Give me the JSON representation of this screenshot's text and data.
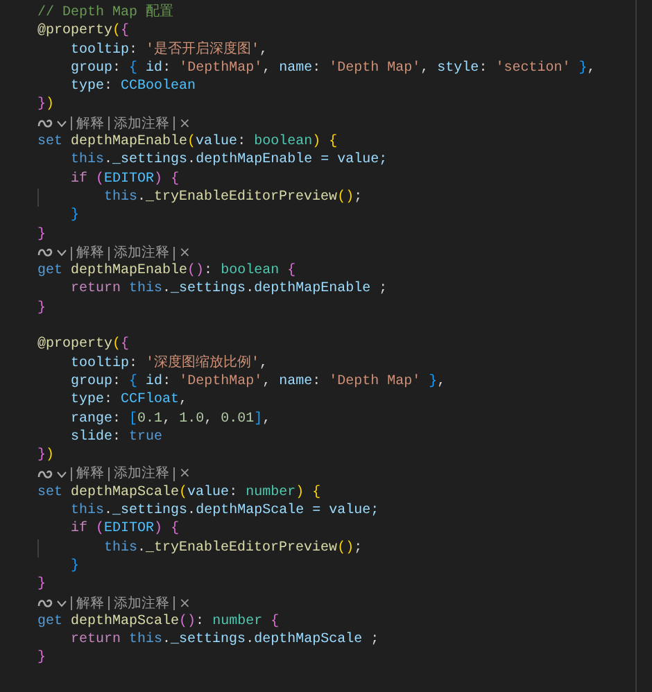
{
  "editor": {
    "lines": [
      {
        "kind": "code",
        "tokens": [
          {
            "text": "// Depth Map 配置",
            "color": "#6a9955"
          }
        ]
      },
      {
        "kind": "code",
        "tokens": [
          {
            "text": "@property",
            "color": "#dcdcaa"
          },
          {
            "text": "(",
            "color": "#ffd700"
          },
          {
            "text": "{",
            "color": "#da70d6"
          }
        ]
      },
      {
        "kind": "code",
        "tokens": [
          {
            "text": "    tooltip",
            "color": "#9cdcfe"
          },
          {
            "text": ": ",
            "color": "#d4d4d4"
          },
          {
            "text": "'是否开启深度图'",
            "color": "#ce9178"
          },
          {
            "text": ",",
            "color": "#d4d4d4"
          }
        ]
      },
      {
        "kind": "code",
        "tokens": [
          {
            "text": "    group",
            "color": "#9cdcfe"
          },
          {
            "text": ": ",
            "color": "#d4d4d4"
          },
          {
            "text": "{",
            "color": "#179fff"
          },
          {
            "text": " id",
            "color": "#9cdcfe"
          },
          {
            "text": ": ",
            "color": "#d4d4d4"
          },
          {
            "text": "'DepthMap'",
            "color": "#ce9178"
          },
          {
            "text": ", ",
            "color": "#d4d4d4"
          },
          {
            "text": "name",
            "color": "#9cdcfe"
          },
          {
            "text": ": ",
            "color": "#d4d4d4"
          },
          {
            "text": "'Depth Map'",
            "color": "#ce9178"
          },
          {
            "text": ", ",
            "color": "#d4d4d4"
          },
          {
            "text": "style",
            "color": "#9cdcfe"
          },
          {
            "text": ": ",
            "color": "#d4d4d4"
          },
          {
            "text": "'section'",
            "color": "#ce9178"
          },
          {
            "text": " }",
            "color": "#179fff"
          },
          {
            "text": ",",
            "color": "#d4d4d4"
          }
        ]
      },
      {
        "kind": "code",
        "tokens": [
          {
            "text": "    type",
            "color": "#9cdcfe"
          },
          {
            "text": ": ",
            "color": "#d4d4d4"
          },
          {
            "text": "CCBoolean",
            "color": "#4fc1ff"
          }
        ]
      },
      {
        "kind": "code",
        "tokens": [
          {
            "text": "}",
            "color": "#da70d6"
          },
          {
            "text": ")",
            "color": "#ffd700"
          }
        ]
      },
      {
        "kind": "codelens",
        "actions": [
          "解释",
          "添加注释"
        ],
        "close": "×"
      },
      {
        "kind": "code",
        "tokens": [
          {
            "text": "set",
            "color": "#569cd6"
          },
          {
            "text": " depthMapEnable",
            "color": "#dcdcaa"
          },
          {
            "text": "(",
            "color": "#ffd700"
          },
          {
            "text": "value",
            "color": "#9cdcfe"
          },
          {
            "text": ": ",
            "color": "#d4d4d4"
          },
          {
            "text": "boolean",
            "color": "#4ec9b0"
          },
          {
            "text": ")",
            "color": "#ffd700"
          },
          {
            "text": " {",
            "color": "#ffd700"
          }
        ]
      },
      {
        "kind": "code",
        "tokens": [
          {
            "text": "    this",
            "color": "#569cd6"
          },
          {
            "text": ".",
            "color": "#d4d4d4"
          },
          {
            "text": "_settings",
            "color": "#9cdcfe"
          },
          {
            "text": ".",
            "color": "#d4d4d4"
          },
          {
            "text": "depthMapEnable",
            "color": "#9cdcfe"
          },
          {
            "text": " = value;",
            "color": "#9cdcfe"
          }
        ]
      },
      {
        "kind": "code",
        "tokens": [
          {
            "text": "    if",
            "color": "#c586c0"
          },
          {
            "text": " (",
            "color": "#da70d6"
          },
          {
            "text": "EDITOR",
            "color": "#4fc1ff"
          },
          {
            "text": ")",
            "color": "#da70d6"
          },
          {
            "text": " {",
            "color": "#da70d6"
          }
        ]
      },
      {
        "kind": "code",
        "tokens": [
          {
            "text": "        this",
            "color": "#569cd6"
          },
          {
            "text": ".",
            "color": "#d4d4d4"
          },
          {
            "text": "_tryEnableEditorPreview",
            "color": "#dcdcaa"
          },
          {
            "text": "()",
            "color": "#ffd700"
          },
          {
            "text": ";",
            "color": "#d4d4d4"
          }
        ]
      },
      {
        "kind": "code",
        "tokens": [
          {
            "text": "    }",
            "color": "#179fff"
          }
        ]
      },
      {
        "kind": "code",
        "tokens": [
          {
            "text": "}",
            "color": "#da70d6"
          }
        ]
      },
      {
        "kind": "codelens",
        "actions": [
          "解释",
          "添加注释"
        ],
        "close": "×"
      },
      {
        "kind": "code",
        "tokens": [
          {
            "text": "get",
            "color": "#569cd6"
          },
          {
            "text": " depthMapEnable",
            "color": "#dcdcaa"
          },
          {
            "text": "()",
            "color": "#da70d6"
          },
          {
            "text": ": ",
            "color": "#d4d4d4"
          },
          {
            "text": "boolean",
            "color": "#4ec9b0"
          },
          {
            "text": " {",
            "color": "#da70d6"
          }
        ]
      },
      {
        "kind": "code",
        "tokens": [
          {
            "text": "    return",
            "color": "#c586c0"
          },
          {
            "text": " this",
            "color": "#569cd6"
          },
          {
            "text": ".",
            "color": "#d4d4d4"
          },
          {
            "text": "_settings",
            "color": "#9cdcfe"
          },
          {
            "text": ".",
            "color": "#d4d4d4"
          },
          {
            "text": "depthMapEnable",
            "color": "#9cdcfe"
          },
          {
            "text": " ;",
            "color": "#d4d4d4"
          }
        ]
      },
      {
        "kind": "code",
        "tokens": [
          {
            "text": "}",
            "color": "#da70d6"
          }
        ]
      },
      {
        "kind": "blank"
      },
      {
        "kind": "code",
        "tokens": [
          {
            "text": "@property",
            "color": "#dcdcaa"
          },
          {
            "text": "(",
            "color": "#ffd700"
          },
          {
            "text": "{",
            "color": "#da70d6"
          }
        ]
      },
      {
        "kind": "code",
        "tokens": [
          {
            "text": "    tooltip",
            "color": "#9cdcfe"
          },
          {
            "text": ": ",
            "color": "#d4d4d4"
          },
          {
            "text": "'深度图缩放比例'",
            "color": "#ce9178"
          },
          {
            "text": ",",
            "color": "#d4d4d4"
          }
        ]
      },
      {
        "kind": "code",
        "tokens": [
          {
            "text": "    group",
            "color": "#9cdcfe"
          },
          {
            "text": ": ",
            "color": "#d4d4d4"
          },
          {
            "text": "{",
            "color": "#179fff"
          },
          {
            "text": " id",
            "color": "#9cdcfe"
          },
          {
            "text": ": ",
            "color": "#d4d4d4"
          },
          {
            "text": "'DepthMap'",
            "color": "#ce9178"
          },
          {
            "text": ", ",
            "color": "#d4d4d4"
          },
          {
            "text": "name",
            "color": "#9cdcfe"
          },
          {
            "text": ": ",
            "color": "#d4d4d4"
          },
          {
            "text": "'Depth Map'",
            "color": "#ce9178"
          },
          {
            "text": " }",
            "color": "#179fff"
          },
          {
            "text": ",",
            "color": "#d4d4d4"
          }
        ]
      },
      {
        "kind": "code",
        "tokens": [
          {
            "text": "    type",
            "color": "#9cdcfe"
          },
          {
            "text": ": ",
            "color": "#d4d4d4"
          },
          {
            "text": "CCFloat",
            "color": "#4fc1ff"
          },
          {
            "text": ",",
            "color": "#d4d4d4"
          }
        ]
      },
      {
        "kind": "code",
        "tokens": [
          {
            "text": "    range",
            "color": "#9cdcfe"
          },
          {
            "text": ": ",
            "color": "#d4d4d4"
          },
          {
            "text": "[",
            "color": "#179fff"
          },
          {
            "text": "0.1",
            "color": "#b5cea8"
          },
          {
            "text": ", ",
            "color": "#d4d4d4"
          },
          {
            "text": "1.0",
            "color": "#b5cea8"
          },
          {
            "text": ", ",
            "color": "#d4d4d4"
          },
          {
            "text": "0.01",
            "color": "#b5cea8"
          },
          {
            "text": "]",
            "color": "#179fff"
          },
          {
            "text": ",",
            "color": "#d4d4d4"
          }
        ]
      },
      {
        "kind": "code",
        "tokens": [
          {
            "text": "    slide",
            "color": "#9cdcfe"
          },
          {
            "text": ": ",
            "color": "#d4d4d4"
          },
          {
            "text": "true",
            "color": "#569cd6"
          }
        ]
      },
      {
        "kind": "code",
        "tokens": [
          {
            "text": "}",
            "color": "#da70d6"
          },
          {
            "text": ")",
            "color": "#ffd700"
          }
        ]
      },
      {
        "kind": "codelens",
        "actions": [
          "解释",
          "添加注释"
        ],
        "close": "×"
      },
      {
        "kind": "code",
        "tokens": [
          {
            "text": "set",
            "color": "#569cd6"
          },
          {
            "text": " depthMapScale",
            "color": "#dcdcaa"
          },
          {
            "text": "(",
            "color": "#ffd700"
          },
          {
            "text": "value",
            "color": "#9cdcfe"
          },
          {
            "text": ": ",
            "color": "#d4d4d4"
          },
          {
            "text": "number",
            "color": "#4ec9b0"
          },
          {
            "text": ")",
            "color": "#ffd700"
          },
          {
            "text": " {",
            "color": "#ffd700"
          }
        ]
      },
      {
        "kind": "code",
        "tokens": [
          {
            "text": "    this",
            "color": "#569cd6"
          },
          {
            "text": ".",
            "color": "#d4d4d4"
          },
          {
            "text": "_settings",
            "color": "#9cdcfe"
          },
          {
            "text": ".",
            "color": "#d4d4d4"
          },
          {
            "text": "depthMapScale",
            "color": "#9cdcfe"
          },
          {
            "text": " = value;",
            "color": "#9cdcfe"
          }
        ]
      },
      {
        "kind": "code",
        "tokens": [
          {
            "text": "    if",
            "color": "#c586c0"
          },
          {
            "text": " (",
            "color": "#da70d6"
          },
          {
            "text": "EDITOR",
            "color": "#4fc1ff"
          },
          {
            "text": ")",
            "color": "#da70d6"
          },
          {
            "text": " {",
            "color": "#da70d6"
          }
        ]
      },
      {
        "kind": "code",
        "tokens": [
          {
            "text": "        this",
            "color": "#569cd6"
          },
          {
            "text": ".",
            "color": "#d4d4d4"
          },
          {
            "text": "_tryEnableEditorPreview",
            "color": "#dcdcaa"
          },
          {
            "text": "()",
            "color": "#ffd700"
          },
          {
            "text": ";",
            "color": "#d4d4d4"
          }
        ]
      },
      {
        "kind": "code",
        "tokens": [
          {
            "text": "    }",
            "color": "#179fff"
          }
        ]
      },
      {
        "kind": "code",
        "tokens": [
          {
            "text": "}",
            "color": "#da70d6"
          }
        ]
      },
      {
        "kind": "codelens",
        "actions": [
          "解释",
          "添加注释"
        ],
        "close": "×"
      },
      {
        "kind": "code",
        "tokens": [
          {
            "text": "get",
            "color": "#569cd6"
          },
          {
            "text": " depthMapScale",
            "color": "#dcdcaa"
          },
          {
            "text": "()",
            "color": "#da70d6"
          },
          {
            "text": ": ",
            "color": "#d4d4d4"
          },
          {
            "text": "number",
            "color": "#4ec9b0"
          },
          {
            "text": " {",
            "color": "#da70d6"
          }
        ]
      },
      {
        "kind": "code",
        "tokens": [
          {
            "text": "    return",
            "color": "#c586c0"
          },
          {
            "text": " this",
            "color": "#569cd6"
          },
          {
            "text": ".",
            "color": "#d4d4d4"
          },
          {
            "text": "_settings",
            "color": "#9cdcfe"
          },
          {
            "text": ".",
            "color": "#d4d4d4"
          },
          {
            "text": "depthMapScale",
            "color": "#9cdcfe"
          },
          {
            "text": " ;",
            "color": "#d4d4d4"
          }
        ]
      },
      {
        "kind": "code",
        "tokens": [
          {
            "text": "}",
            "color": "#da70d6"
          }
        ]
      }
    ]
  }
}
